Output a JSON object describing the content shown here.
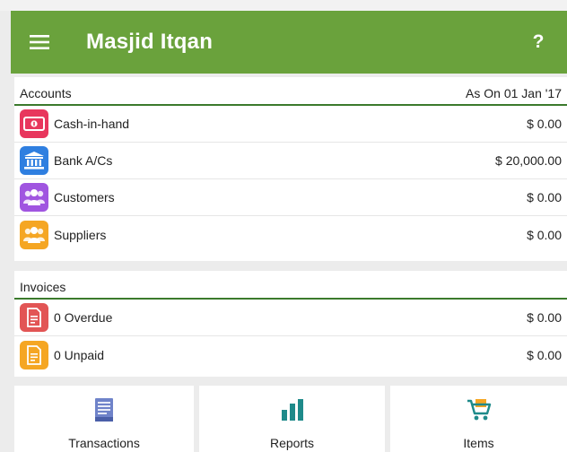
{
  "app": {
    "title": "Masjid Itqan",
    "help_label": "?"
  },
  "accounts": {
    "header": "Accounts",
    "as_on": "As On 01 Jan '17",
    "rows": [
      {
        "label": "Cash-in-hand",
        "value": "$ 0.00",
        "icon": "cash-icon",
        "color": "#e8365d"
      },
      {
        "label": "Bank A/Cs",
        "value": "$ 20,000.00",
        "icon": "bank-icon",
        "color": "#2f7fe0"
      },
      {
        "label": "Customers",
        "value": "$ 0.00",
        "icon": "customers-icon",
        "color": "#a055e0"
      },
      {
        "label": "Suppliers",
        "value": "$ 0.00",
        "icon": "suppliers-icon",
        "color": "#f5a623"
      }
    ]
  },
  "invoices": {
    "header": "Invoices",
    "rows": [
      {
        "label": "0 Overdue",
        "value": "$ 0.00",
        "icon": "overdue-invoice-icon",
        "color": "#e25555"
      },
      {
        "label": "0 Unpaid",
        "value": "$ 0.00",
        "icon": "unpaid-invoice-icon",
        "color": "#f5a623"
      }
    ]
  },
  "tiles": [
    {
      "label": "Transactions",
      "icon": "transactions-icon"
    },
    {
      "label": "Reports",
      "icon": "reports-icon"
    },
    {
      "label": "Items",
      "icon": "items-cart-icon"
    }
  ],
  "colors": {
    "appbar": "#6aa23c",
    "divider": "#3b7a2c"
  }
}
